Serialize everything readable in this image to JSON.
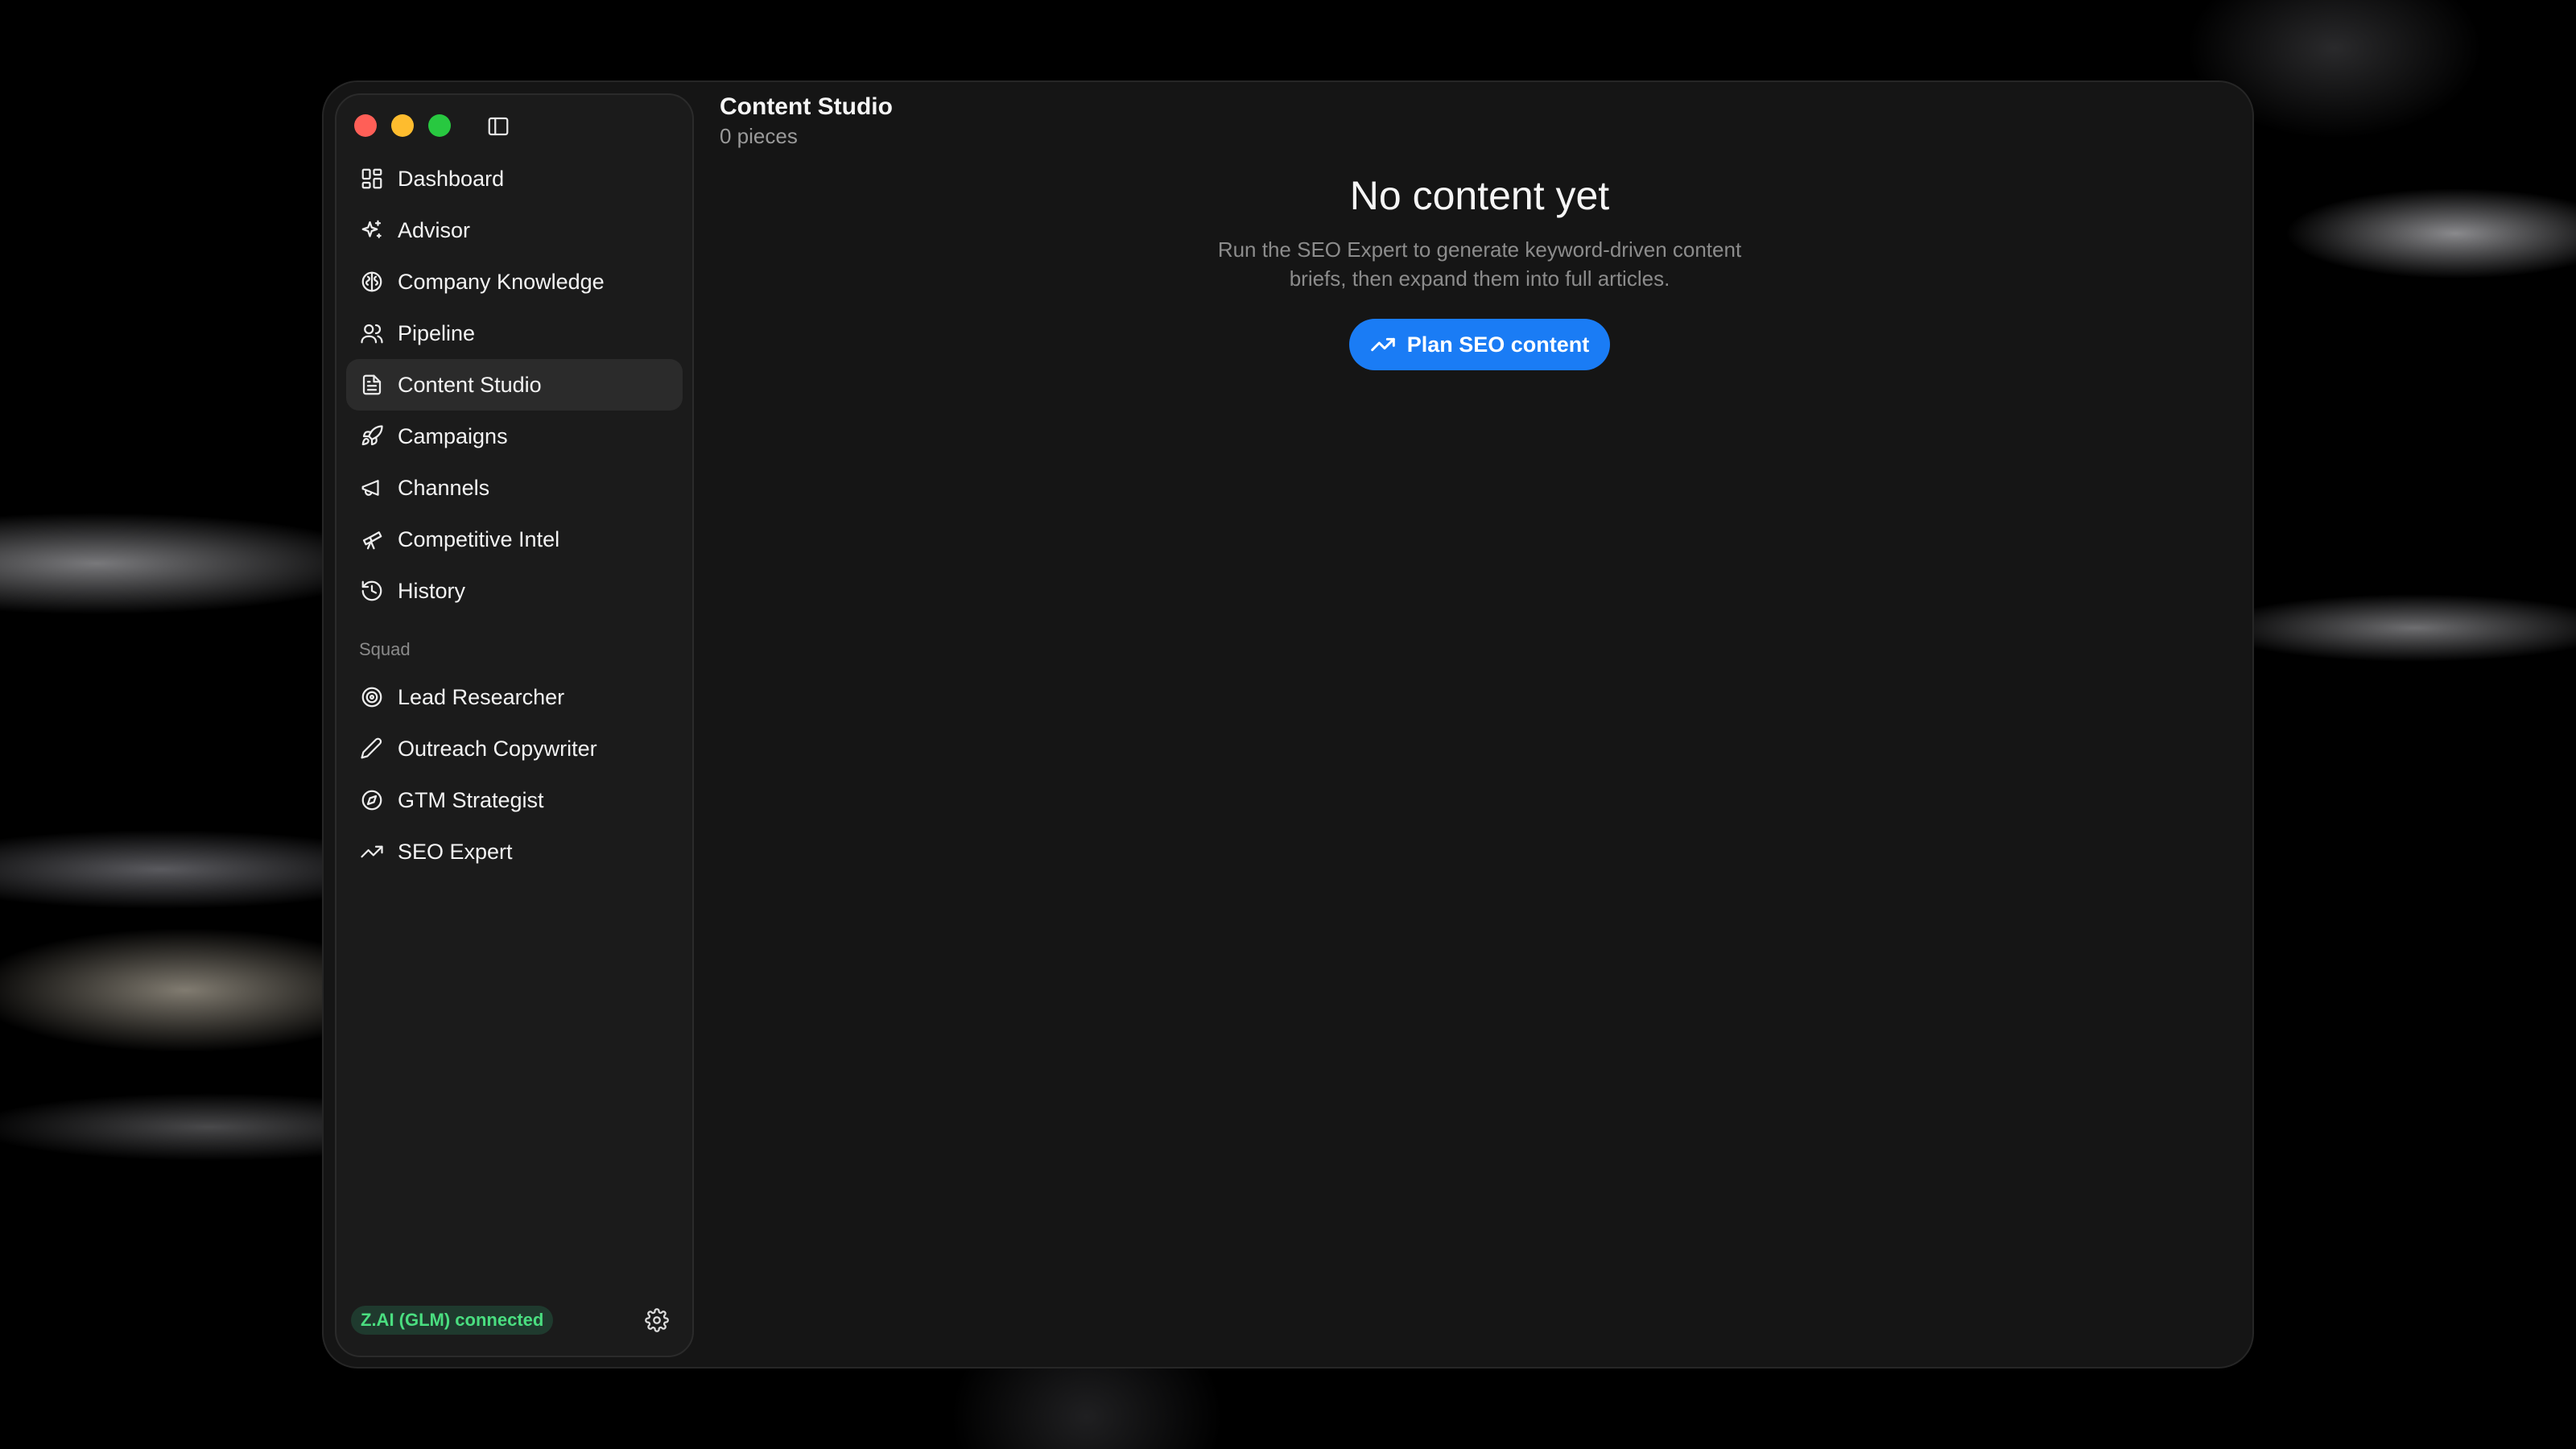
{
  "sidebar": {
    "items": [
      {
        "label": "Dashboard",
        "icon": "dashboard-icon"
      },
      {
        "label": "Advisor",
        "icon": "sparkles-icon"
      },
      {
        "label": "Company Knowledge",
        "icon": "brain-icon"
      },
      {
        "label": "Pipeline",
        "icon": "users-icon"
      },
      {
        "label": "Content Studio",
        "icon": "document-icon",
        "active": true
      },
      {
        "label": "Campaigns",
        "icon": "rocket-icon"
      },
      {
        "label": "Channels",
        "icon": "megaphone-icon"
      },
      {
        "label": "Competitive Intel",
        "icon": "telescope-icon"
      },
      {
        "label": "History",
        "icon": "history-icon"
      }
    ],
    "squad_title": "Squad",
    "squad": [
      {
        "label": "Lead Researcher",
        "icon": "target-icon"
      },
      {
        "label": "Outreach Copywriter",
        "icon": "pen-icon"
      },
      {
        "label": "GTM Strategist",
        "icon": "compass-icon"
      },
      {
        "label": "SEO Expert",
        "icon": "trending-up-icon"
      }
    ],
    "status": "Z.AI (GLM) connected"
  },
  "main": {
    "title": "Content Studio",
    "subtitle": "0 pieces",
    "empty": {
      "title": "No content yet",
      "description": "Run the SEO Expert to generate keyword-driven content briefs, then expand them into full articles.",
      "button_label": "Plan SEO content"
    }
  },
  "colors": {
    "accent": "#1a7cf5",
    "status_green": "#4ade80",
    "window_bg": "#151515",
    "sidebar_bg": "#1b1b1b"
  }
}
